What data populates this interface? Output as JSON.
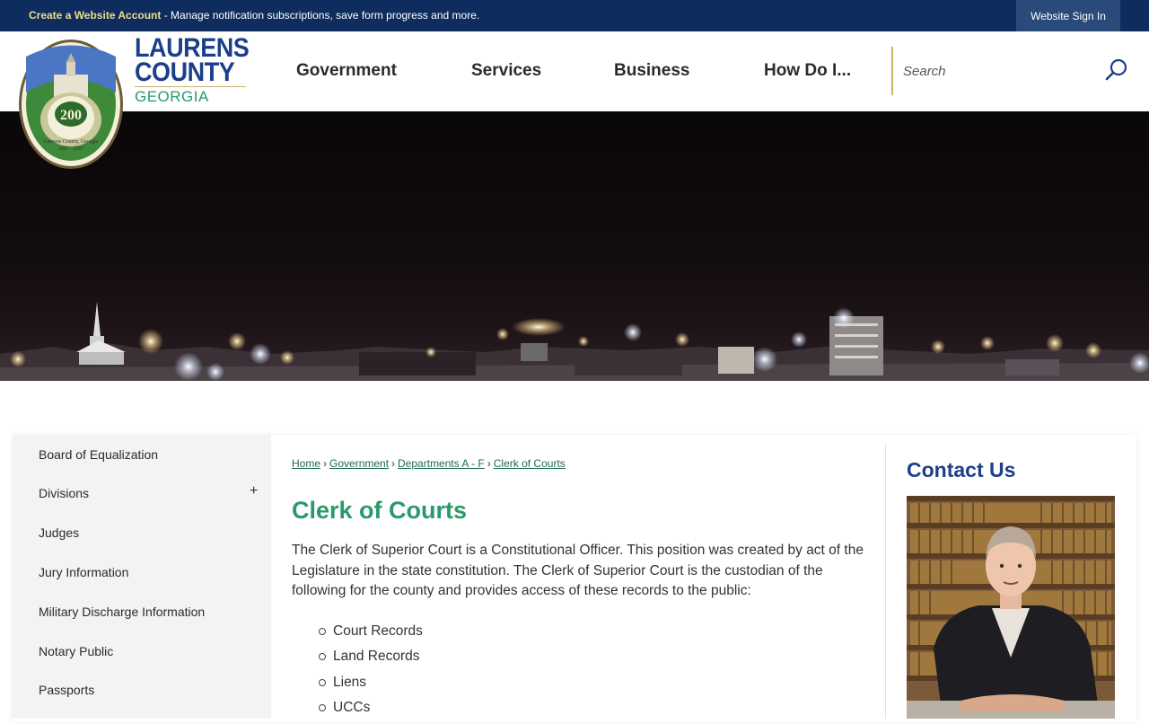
{
  "topbar": {
    "create_account_link": "Create a Website Account",
    "message": " - Manage notification subscriptions, save form progress and more.",
    "sign_in": "Website Sign In"
  },
  "brand": {
    "line1": "LAURENS",
    "line2": "COUNTY",
    "line3": "GEORGIA"
  },
  "nav": {
    "items": [
      {
        "label": "Government"
      },
      {
        "label": "Services"
      },
      {
        "label": "Business"
      },
      {
        "label": "How Do I..."
      }
    ]
  },
  "search": {
    "placeholder": "Search",
    "icon": "search-icon"
  },
  "sidebar": {
    "items": [
      {
        "label": "Board of Equalization"
      },
      {
        "label": "Divisions",
        "expand": "+"
      },
      {
        "label": "Judges"
      },
      {
        "label": "Jury Information"
      },
      {
        "label": "Military Discharge Information"
      },
      {
        "label": "Notary Public"
      },
      {
        "label": "Passports"
      }
    ]
  },
  "breadcrumb": {
    "items": [
      "Home",
      "Government",
      "Departments A - F",
      "Clerk of Courts"
    ],
    "separator": "›"
  },
  "page": {
    "title": "Clerk of Courts",
    "intro": "The Clerk of Superior Court is a Constitutional Officer. This position was created by act of the Legislature in the state constitution. The Clerk of Superior Court is the custodian of the following for the county and provides access of these records to the public:",
    "records": [
      "Court Records",
      "Land Records",
      "Liens",
      "UCCs"
    ]
  },
  "contact": {
    "title": "Contact Us"
  },
  "colors": {
    "topbar": "#0e2d5e",
    "brand_blue": "#1d3f8a",
    "accent_green": "#2a9a6b",
    "gold": "#c9b36a"
  }
}
